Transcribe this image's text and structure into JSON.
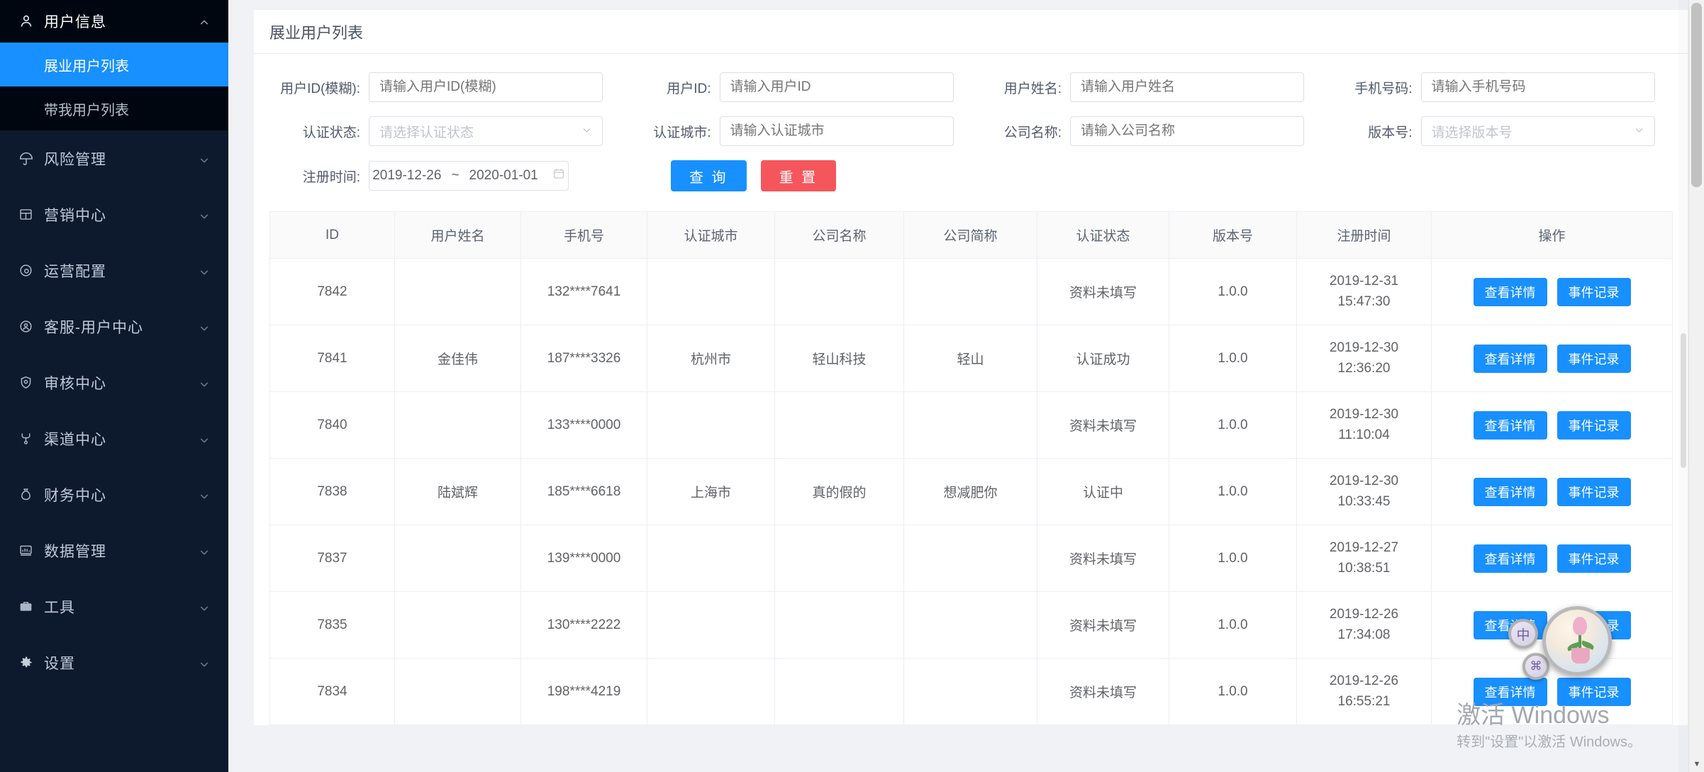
{
  "sidebar": {
    "group": {
      "label": "用户信息",
      "icon": "user-icon",
      "expanded": true,
      "children": [
        {
          "label": "展业用户列表",
          "active": true
        },
        {
          "label": "带我用户列表",
          "active": false
        }
      ]
    },
    "items": [
      {
        "label": "风险管理",
        "icon": "umbrella-icon"
      },
      {
        "label": "营销中心",
        "icon": "grid-icon"
      },
      {
        "label": "运营配置",
        "icon": "gear-circle-icon"
      },
      {
        "label": "客服-用户中心",
        "icon": "headset-icon"
      },
      {
        "label": "审核中心",
        "icon": "shield-icon"
      },
      {
        "label": "渠道中心",
        "icon": "branch-icon"
      },
      {
        "label": "财务中心",
        "icon": "money-bag-icon"
      },
      {
        "label": "数据管理",
        "icon": "chart-icon"
      },
      {
        "label": "工具",
        "icon": "toolbox-icon"
      },
      {
        "label": "设置",
        "icon": "gear-icon"
      }
    ]
  },
  "page": {
    "title": "展业用户列表"
  },
  "filters": {
    "row1": [
      {
        "label": "用户ID(模糊):",
        "placeholder": "请输入用户ID(模糊)",
        "value": "",
        "type": "text"
      },
      {
        "label": "用户ID:",
        "placeholder": "请输入用户ID",
        "value": "",
        "type": "text"
      },
      {
        "label": "用户姓名:",
        "placeholder": "请输入用户姓名",
        "value": "",
        "type": "text"
      },
      {
        "label": "手机号码:",
        "placeholder": "请输入手机号码",
        "value": "",
        "type": "text"
      }
    ],
    "row2": [
      {
        "label": "认证状态:",
        "placeholder": "请选择认证状态",
        "value": "",
        "type": "select"
      },
      {
        "label": "认证城市:",
        "placeholder": "请输入认证城市",
        "value": "",
        "type": "text"
      },
      {
        "label": "公司名称:",
        "placeholder": "请输入公司名称",
        "value": "",
        "type": "text"
      },
      {
        "label": "版本号:",
        "placeholder": "请选择版本号",
        "value": "",
        "type": "select"
      }
    ],
    "date": {
      "label": "注册时间:",
      "start": "2019-12-26",
      "separator": "~",
      "end": "2020-01-01",
      "icon": "calendar-icon"
    },
    "buttons": {
      "query": "查 询",
      "reset": "重 置",
      "query_color": "#1890ff",
      "reset_color": "#f5565c"
    }
  },
  "table": {
    "columns": [
      "ID",
      "用户姓名",
      "手机号",
      "认证城市",
      "公司名称",
      "公司简称",
      "认证状态",
      "版本号",
      "注册时间",
      "操作"
    ],
    "action_labels": {
      "detail": "查看详情",
      "events": "事件记录"
    },
    "rows": [
      {
        "id": "7842",
        "name": "",
        "phone": "132****7641",
        "city": "",
        "company": "",
        "short": "",
        "status": "资料未填写",
        "version": "1.0.0",
        "date": "2019-12-31",
        "time": "15:47:30"
      },
      {
        "id": "7841",
        "name": "金佳伟",
        "phone": "187****3326",
        "city": "杭州市",
        "company": "轻山科技",
        "short": "轻山",
        "status": "认证成功",
        "version": "1.0.0",
        "date": "2019-12-30",
        "time": "12:36:20"
      },
      {
        "id": "7840",
        "name": "",
        "phone": "133****0000",
        "city": "",
        "company": "",
        "short": "",
        "status": "资料未填写",
        "version": "1.0.0",
        "date": "2019-12-30",
        "time": "11:10:04"
      },
      {
        "id": "7838",
        "name": "陆斌辉",
        "phone": "185****6618",
        "city": "上海市",
        "company": "真的假的",
        "short": "想减肥你",
        "status": "认证中",
        "version": "1.0.0",
        "date": "2019-12-30",
        "time": "10:33:45"
      },
      {
        "id": "7837",
        "name": "",
        "phone": "139****0000",
        "city": "",
        "company": "",
        "short": "",
        "status": "资料未填写",
        "version": "1.0.0",
        "date": "2019-12-27",
        "time": "10:38:51"
      },
      {
        "id": "7835",
        "name": "",
        "phone": "130****2222",
        "city": "",
        "company": "",
        "short": "",
        "status": "资料未填写",
        "version": "1.0.0",
        "date": "2019-12-26",
        "time": "17:34:08"
      },
      {
        "id": "7834",
        "name": "",
        "phone": "198****4219",
        "city": "",
        "company": "",
        "short": "",
        "status": "资料未填写",
        "version": "1.0.0",
        "date": "2019-12-26",
        "time": "16:55:21"
      }
    ]
  },
  "watermark": {
    "line1": "激活 Windows",
    "line2": "转到\"设置\"以激活 Windows。"
  },
  "ime": {
    "satellite1": "中",
    "satellite2": "⌘"
  }
}
